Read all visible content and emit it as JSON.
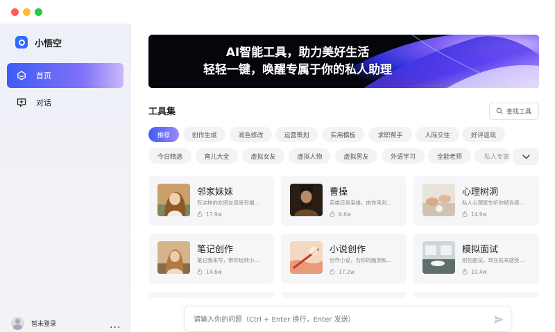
{
  "app": {
    "name": "小悟空"
  },
  "sidebar": {
    "items": [
      {
        "label": "首页",
        "icon": "hexagon-home-icon",
        "active": true
      },
      {
        "label": "对话",
        "icon": "chat-add-icon",
        "active": false
      }
    ],
    "login_label": "暂未登录",
    "more_label": "..."
  },
  "banner": {
    "line1": "AI智能工具，助力美好生活",
    "line2": "轻轻一键，唤醒专属于你的私人助理"
  },
  "tools": {
    "title": "工具集",
    "search_label": "查找工具",
    "chips_row1": [
      "推荐",
      "创作生成",
      "润色修改",
      "运营策划",
      "实用模板",
      "求职帮手",
      "人际交往",
      "好评返现"
    ],
    "chips_row2": [
      "今日精选",
      "育儿大全",
      "虚拟女友",
      "虚拟人物",
      "虚拟男友",
      "外语学习",
      "全能老师",
      "私人专家"
    ],
    "active_chip": "推荐"
  },
  "cards": [
    {
      "title": "邻家妹妹",
      "desc": "有这样的女朋友真是有福...",
      "count": "17.9w"
    },
    {
      "title": "曹操",
      "desc": "英雄还是枭雄，由你来判...",
      "count": "6.6w"
    },
    {
      "title": "心理树洞",
      "desc": "私人心理医生听你倾诉烦...",
      "count": "14.9w"
    },
    {
      "title": "笔记创作",
      "desc": "笔记我来写，帮你玩转小...",
      "count": "14.6w"
    },
    {
      "title": "小说创作",
      "desc": "创作小说，为你的脑洞私...",
      "count": "17.2w"
    },
    {
      "title": "模拟面试",
      "desc": "别怕面试，现在就来感受...",
      "count": "10.4w"
    }
  ],
  "input": {
    "placeholder": "请输入你的问题（Ctrl + Enter 换行，Enter 发送）"
  },
  "colors": {
    "accent": "#3d5cf5",
    "accent_light": "#c9b8fb",
    "sidebar_bg": "#eef0f8",
    "card_bg": "#f6f6f8"
  }
}
